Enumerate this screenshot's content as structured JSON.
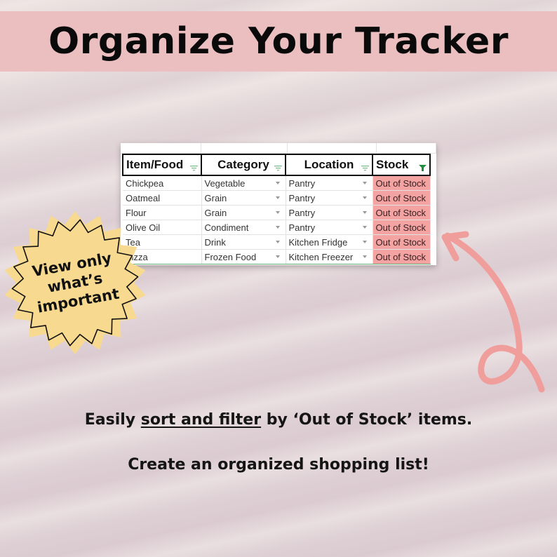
{
  "header": {
    "title": "Organize Your Tracker"
  },
  "spreadsheet": {
    "columns": [
      {
        "label": "Item/Food",
        "filter_active": false
      },
      {
        "label": "Category",
        "filter_active": false
      },
      {
        "label": "Location",
        "filter_active": false
      },
      {
        "label": "Stock",
        "filter_active": true
      }
    ],
    "rows": [
      {
        "item": "Chickpea",
        "category": "Vegetable",
        "location": "Pantry",
        "stock": "Out of Stock"
      },
      {
        "item": "Oatmeal",
        "category": "Grain",
        "location": "Pantry",
        "stock": "Out of Stock"
      },
      {
        "item": "Flour",
        "category": "Grain",
        "location": "Pantry",
        "stock": "Out of Stock"
      },
      {
        "item": "Olive Oil",
        "category": "Condiment",
        "location": "Pantry",
        "stock": "Out of Stock"
      },
      {
        "item": "Tea",
        "category": "Drink",
        "location": "Kitchen Fridge",
        "stock": "Out of Stock"
      },
      {
        "item": "Pizza",
        "category": "Frozen Food",
        "location": "Kitchen Freezer",
        "stock": "Out of Stock"
      }
    ],
    "colors": {
      "out_of_stock_fill": "#f4a3a3",
      "filter_icon": "#1e8e3e"
    }
  },
  "badge": {
    "lines": [
      "View only",
      "what’s",
      "important"
    ],
    "fill": "#f7d98f"
  },
  "captions": {
    "line1_prefix": "Easily ",
    "line1_underlined": "sort and filter",
    "line1_suffix": " by ‘Out of Stock’ items.",
    "line2": "Create an organized shopping list!"
  },
  "colors": {
    "banner": "#ebbfc0",
    "arrow": "#ef9e9c"
  }
}
